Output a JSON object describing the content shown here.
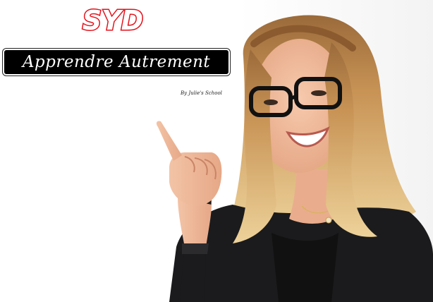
{
  "brand": {
    "logo_text": "SYD",
    "logo_color": "#e3121b"
  },
  "banner": {
    "title": "Apprendre Autrement"
  },
  "byline": "By Julie's School",
  "photo": {
    "subject": "smiling-woman-pointing-up",
    "hair_color": "#d7a75e",
    "jacket_color": "#1b1b1d",
    "skin_color": "#f0b79c"
  }
}
